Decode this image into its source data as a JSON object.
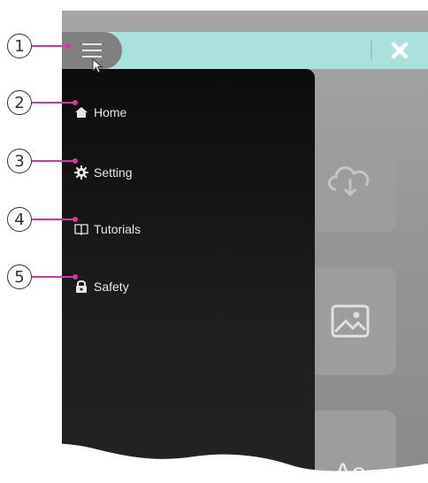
{
  "menu": {
    "items": [
      {
        "label": "Home",
        "icon": "home-icon"
      },
      {
        "label": "Setting",
        "icon": "gear-icon"
      },
      {
        "label": "Tutorials",
        "icon": "book-icon"
      },
      {
        "label": "Safety",
        "icon": "lock-icon"
      }
    ]
  },
  "tiles": {
    "third_label": "Aa"
  },
  "callouts": [
    "1",
    "2",
    "3",
    "4",
    "5"
  ],
  "colors": {
    "accent_topbar": "#a9e2dc",
    "callout_line": "#d4369d",
    "drawer_bg": "#111111",
    "screen_bg": "#979797"
  }
}
